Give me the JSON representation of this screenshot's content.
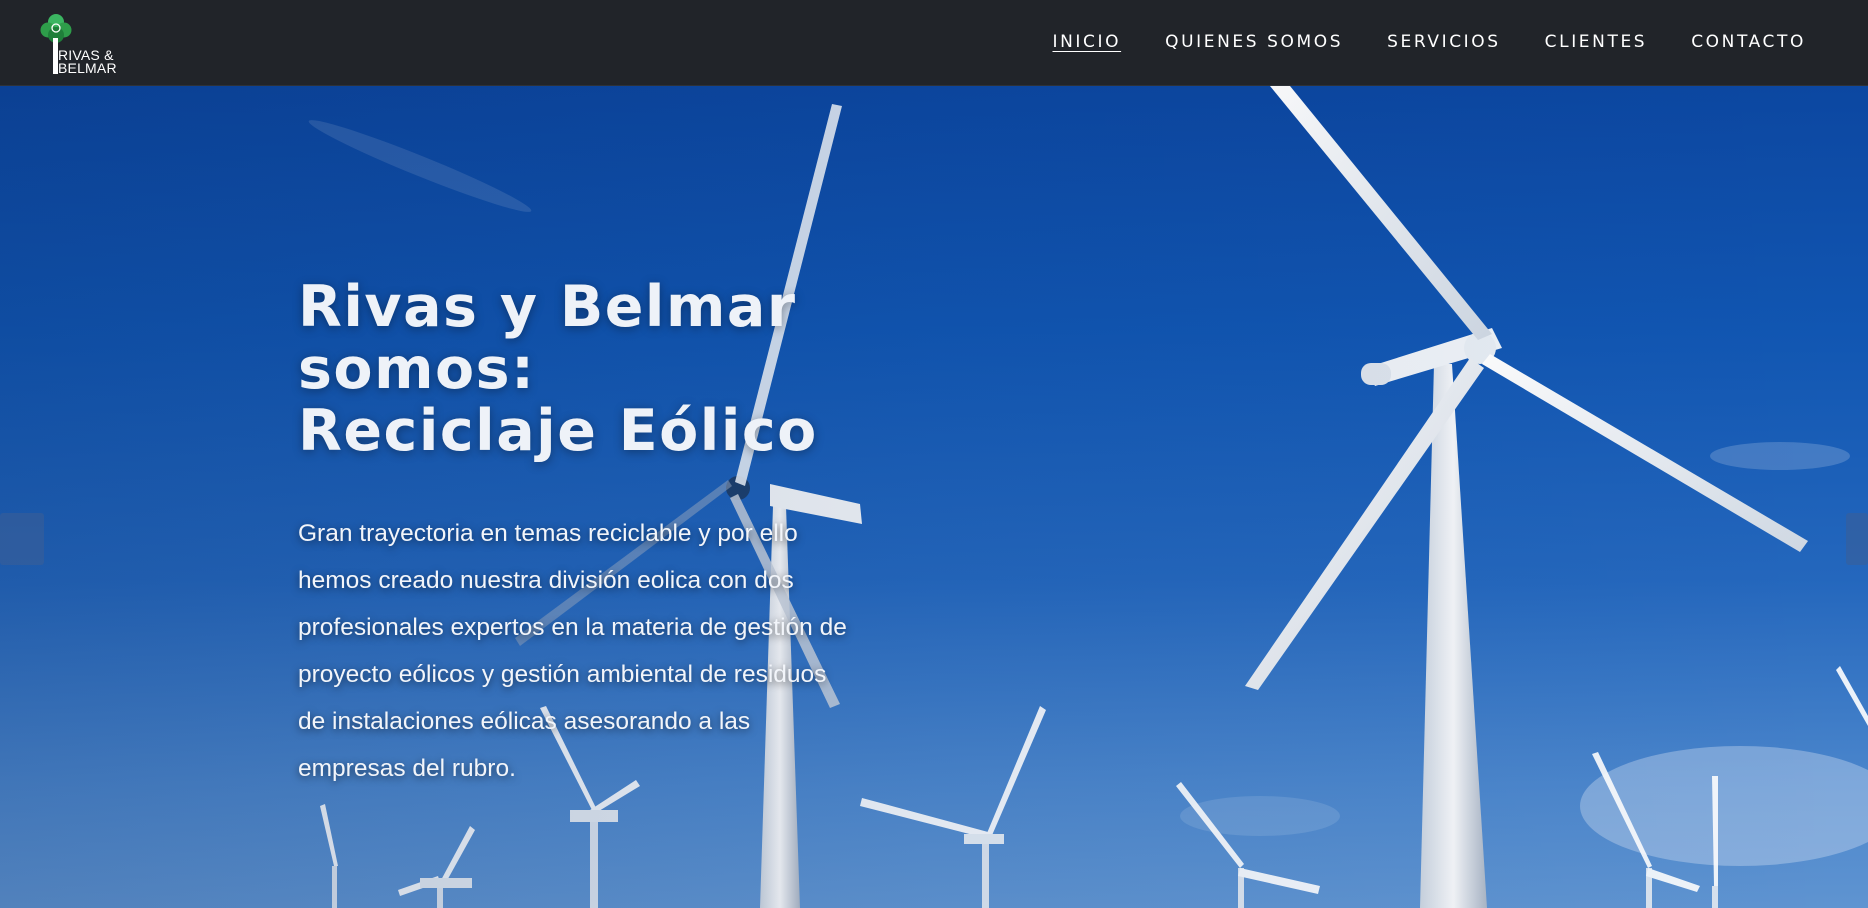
{
  "brand": {
    "logo_line1": "RIVAS &",
    "logo_line2": "BELMAR",
    "logo_icon": "tree-icon",
    "tree_color": "#2e9d4a"
  },
  "nav": {
    "items": [
      {
        "label": "INICIO",
        "active": true
      },
      {
        "label": "QUIENES SOMOS",
        "active": false
      },
      {
        "label": "SERVICIOS",
        "active": false
      },
      {
        "label": "CLIENTES",
        "active": false
      },
      {
        "label": "CONTACTO",
        "active": false
      }
    ]
  },
  "hero": {
    "title_line1": "Rivas y Belmar",
    "title_line2": "somos:",
    "title_line3": "Reciclaje Eólico",
    "description": "Gran trayectoria en temas reciclable y por ello hemos creado nuestra división eolica con dos profesionales expertos en la materia de gestión de proyecto eólicos y gestión ambiental de residuos de instalaciones eólicas asesorando a las empresas del rubro.",
    "background": "wind-turbines-photo",
    "arrow_prev_icon": "chevron-left-icon",
    "arrow_next_icon": "chevron-right-icon"
  },
  "colors": {
    "navbar_bg": "#212429",
    "sky": "#1156b2"
  }
}
